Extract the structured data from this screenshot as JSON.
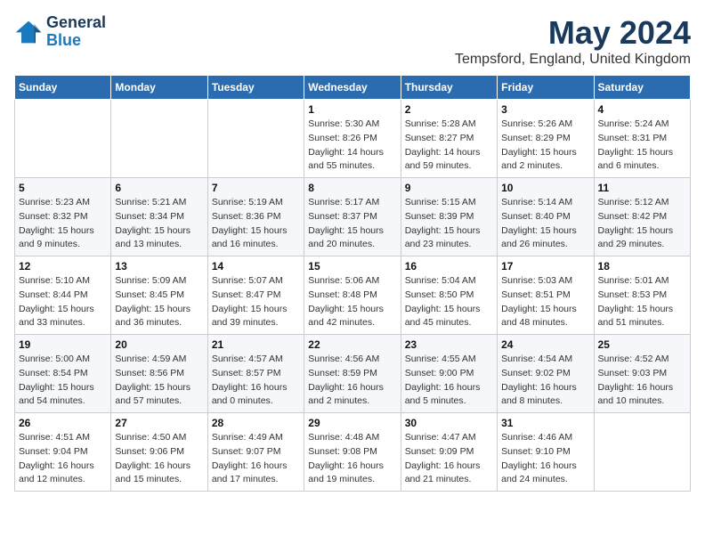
{
  "header": {
    "logo_line1": "General",
    "logo_line2": "Blue",
    "month_title": "May 2024",
    "location": "Tempsford, England, United Kingdom"
  },
  "weekdays": [
    "Sunday",
    "Monday",
    "Tuesday",
    "Wednesday",
    "Thursday",
    "Friday",
    "Saturday"
  ],
  "weeks": [
    [
      {
        "day": "",
        "info": ""
      },
      {
        "day": "",
        "info": ""
      },
      {
        "day": "",
        "info": ""
      },
      {
        "day": "1",
        "info": "Sunrise: 5:30 AM\nSunset: 8:26 PM\nDaylight: 14 hours\nand 55 minutes."
      },
      {
        "day": "2",
        "info": "Sunrise: 5:28 AM\nSunset: 8:27 PM\nDaylight: 14 hours\nand 59 minutes."
      },
      {
        "day": "3",
        "info": "Sunrise: 5:26 AM\nSunset: 8:29 PM\nDaylight: 15 hours\nand 2 minutes."
      },
      {
        "day": "4",
        "info": "Sunrise: 5:24 AM\nSunset: 8:31 PM\nDaylight: 15 hours\nand 6 minutes."
      }
    ],
    [
      {
        "day": "5",
        "info": "Sunrise: 5:23 AM\nSunset: 8:32 PM\nDaylight: 15 hours\nand 9 minutes."
      },
      {
        "day": "6",
        "info": "Sunrise: 5:21 AM\nSunset: 8:34 PM\nDaylight: 15 hours\nand 13 minutes."
      },
      {
        "day": "7",
        "info": "Sunrise: 5:19 AM\nSunset: 8:36 PM\nDaylight: 15 hours\nand 16 minutes."
      },
      {
        "day": "8",
        "info": "Sunrise: 5:17 AM\nSunset: 8:37 PM\nDaylight: 15 hours\nand 20 minutes."
      },
      {
        "day": "9",
        "info": "Sunrise: 5:15 AM\nSunset: 8:39 PM\nDaylight: 15 hours\nand 23 minutes."
      },
      {
        "day": "10",
        "info": "Sunrise: 5:14 AM\nSunset: 8:40 PM\nDaylight: 15 hours\nand 26 minutes."
      },
      {
        "day": "11",
        "info": "Sunrise: 5:12 AM\nSunset: 8:42 PM\nDaylight: 15 hours\nand 29 minutes."
      }
    ],
    [
      {
        "day": "12",
        "info": "Sunrise: 5:10 AM\nSunset: 8:44 PM\nDaylight: 15 hours\nand 33 minutes."
      },
      {
        "day": "13",
        "info": "Sunrise: 5:09 AM\nSunset: 8:45 PM\nDaylight: 15 hours\nand 36 minutes."
      },
      {
        "day": "14",
        "info": "Sunrise: 5:07 AM\nSunset: 8:47 PM\nDaylight: 15 hours\nand 39 minutes."
      },
      {
        "day": "15",
        "info": "Sunrise: 5:06 AM\nSunset: 8:48 PM\nDaylight: 15 hours\nand 42 minutes."
      },
      {
        "day": "16",
        "info": "Sunrise: 5:04 AM\nSunset: 8:50 PM\nDaylight: 15 hours\nand 45 minutes."
      },
      {
        "day": "17",
        "info": "Sunrise: 5:03 AM\nSunset: 8:51 PM\nDaylight: 15 hours\nand 48 minutes."
      },
      {
        "day": "18",
        "info": "Sunrise: 5:01 AM\nSunset: 8:53 PM\nDaylight: 15 hours\nand 51 minutes."
      }
    ],
    [
      {
        "day": "19",
        "info": "Sunrise: 5:00 AM\nSunset: 8:54 PM\nDaylight: 15 hours\nand 54 minutes."
      },
      {
        "day": "20",
        "info": "Sunrise: 4:59 AM\nSunset: 8:56 PM\nDaylight: 15 hours\nand 57 minutes."
      },
      {
        "day": "21",
        "info": "Sunrise: 4:57 AM\nSunset: 8:57 PM\nDaylight: 16 hours\nand 0 minutes."
      },
      {
        "day": "22",
        "info": "Sunrise: 4:56 AM\nSunset: 8:59 PM\nDaylight: 16 hours\nand 2 minutes."
      },
      {
        "day": "23",
        "info": "Sunrise: 4:55 AM\nSunset: 9:00 PM\nDaylight: 16 hours\nand 5 minutes."
      },
      {
        "day": "24",
        "info": "Sunrise: 4:54 AM\nSunset: 9:02 PM\nDaylight: 16 hours\nand 8 minutes."
      },
      {
        "day": "25",
        "info": "Sunrise: 4:52 AM\nSunset: 9:03 PM\nDaylight: 16 hours\nand 10 minutes."
      }
    ],
    [
      {
        "day": "26",
        "info": "Sunrise: 4:51 AM\nSunset: 9:04 PM\nDaylight: 16 hours\nand 12 minutes."
      },
      {
        "day": "27",
        "info": "Sunrise: 4:50 AM\nSunset: 9:06 PM\nDaylight: 16 hours\nand 15 minutes."
      },
      {
        "day": "28",
        "info": "Sunrise: 4:49 AM\nSunset: 9:07 PM\nDaylight: 16 hours\nand 17 minutes."
      },
      {
        "day": "29",
        "info": "Sunrise: 4:48 AM\nSunset: 9:08 PM\nDaylight: 16 hours\nand 19 minutes."
      },
      {
        "day": "30",
        "info": "Sunrise: 4:47 AM\nSunset: 9:09 PM\nDaylight: 16 hours\nand 21 minutes."
      },
      {
        "day": "31",
        "info": "Sunrise: 4:46 AM\nSunset: 9:10 PM\nDaylight: 16 hours\nand 24 minutes."
      },
      {
        "day": "",
        "info": ""
      }
    ]
  ]
}
